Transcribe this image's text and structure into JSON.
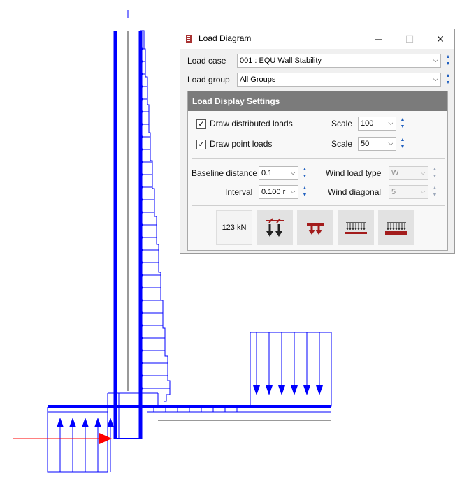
{
  "window": {
    "title": "Load Diagram",
    "minimize_symbol": "─",
    "maximize_symbol": "☐",
    "close_symbol": "✕"
  },
  "form": {
    "load_case_label": "Load case",
    "load_case_value": "001 : EQU Wall Stability",
    "load_group_label": "Load group",
    "load_group_value": "All Groups"
  },
  "settings": {
    "header": "Load Display Settings",
    "draw_distributed_label": "Draw distributed loads",
    "draw_distributed_checked": true,
    "draw_point_label": "Draw point loads",
    "draw_point_checked": true,
    "scale_label": "Scale",
    "distributed_scale": "100",
    "point_scale": "50",
    "baseline_distance_label": "Baseline distance",
    "baseline_distance_value": "0.1",
    "interval_label": "Interval",
    "interval_value": "0.100 r",
    "wind_load_type_label": "Wind load type",
    "wind_load_type_value": "W",
    "wind_diagonal_label": "Wind diagonal",
    "wind_diagonal_value": "5",
    "load_value_button": "123 kN"
  },
  "icons": {
    "window": "load-diagram-icon",
    "tools": [
      "point-load-display-icon",
      "distributed-load-red-icon",
      "uniform-load-icon",
      "uniform-load-red-icon"
    ]
  },
  "colors": {
    "structure_blue": "#0000ff",
    "arrow_red": "#ff0000",
    "tool_red": "#a31c1c",
    "group_header": "#7b7b7b"
  }
}
